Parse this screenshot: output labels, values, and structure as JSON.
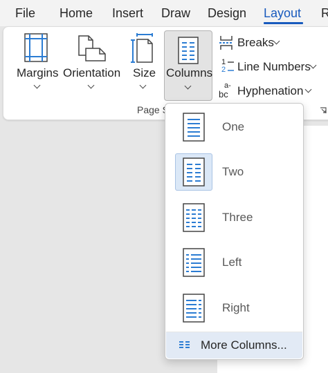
{
  "tabs": [
    {
      "label": "File",
      "active": false
    },
    {
      "label": "Home",
      "active": false
    },
    {
      "label": "Insert",
      "active": false
    },
    {
      "label": "Draw",
      "active": false
    },
    {
      "label": "Design",
      "active": false
    },
    {
      "label": "Layout",
      "active": true
    },
    {
      "label": "R",
      "active": false
    }
  ],
  "ribbon": {
    "margins_label": "Margins",
    "orientation_label": "Orientation",
    "size_label": "Size",
    "columns_label": "Columns",
    "breaks_label": "Breaks",
    "line_numbers_label": "Line Numbers",
    "hyphenation_label": "Hyphenation",
    "group_label": "Page S",
    "line_numbers_icon_top": "1",
    "line_numbers_icon_bottom": "2",
    "hyphenation_icon_top": "a-",
    "hyphenation_icon_bottom": "bc"
  },
  "columns_menu": {
    "items": [
      {
        "label": "One",
        "selected": false
      },
      {
        "label": "Two",
        "selected": true
      },
      {
        "label": "Three",
        "selected": false
      },
      {
        "label": "Left",
        "selected": false
      },
      {
        "label": "Right",
        "selected": false
      }
    ],
    "more_label": "More Columns..."
  },
  "colors": {
    "accent": "#185abd",
    "icon_blue": "#2b7cd3",
    "menu_selected": "#dbe8f7"
  }
}
